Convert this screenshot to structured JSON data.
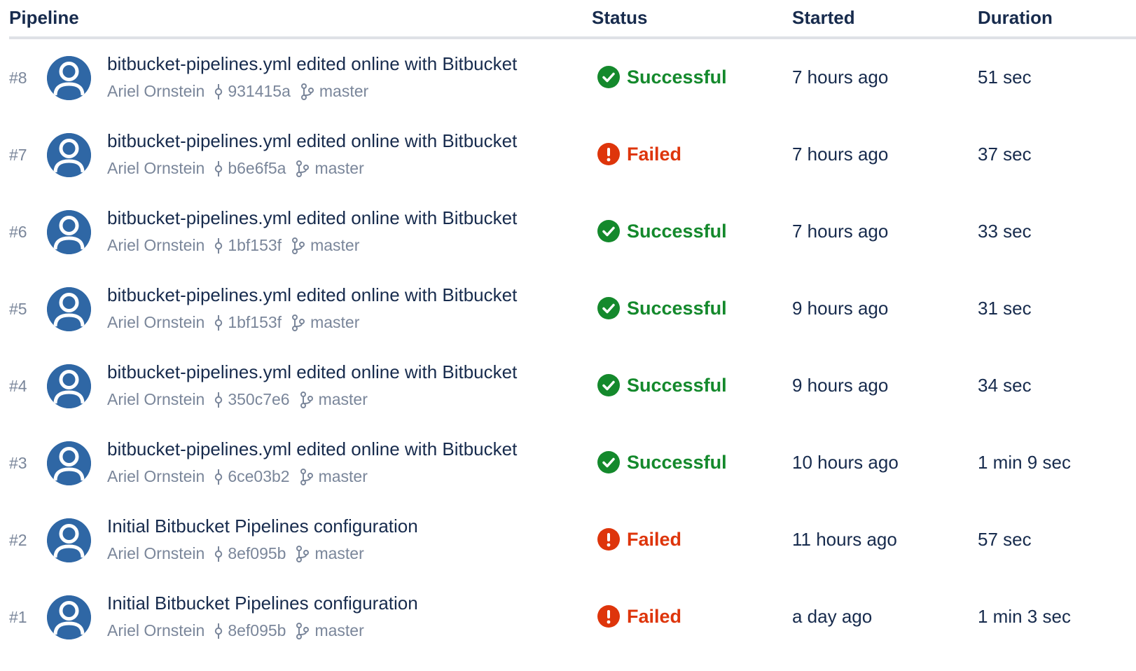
{
  "columns": {
    "pipeline": "Pipeline",
    "status": "Status",
    "started": "Started",
    "duration": "Duration"
  },
  "colors": {
    "success": "#14892c",
    "failed": "#de350b",
    "avatar": "#2f67a5",
    "text": "#172b4d",
    "muted": "#7a869a"
  },
  "rows": [
    {
      "number": "#8",
      "message": "bitbucket-pipelines.yml edited online with Bitbucket",
      "author": "Ariel Ornstein",
      "commit": "931415a",
      "branch": "master",
      "status": "Successful",
      "status_type": "success",
      "started": "7 hours ago",
      "duration": "51 sec"
    },
    {
      "number": "#7",
      "message": "bitbucket-pipelines.yml edited online with Bitbucket",
      "author": "Ariel Ornstein",
      "commit": "b6e6f5a",
      "branch": "master",
      "status": "Failed",
      "status_type": "failed",
      "started": "7 hours ago",
      "duration": "37 sec"
    },
    {
      "number": "#6",
      "message": "bitbucket-pipelines.yml edited online with Bitbucket",
      "author": "Ariel Ornstein",
      "commit": "1bf153f",
      "branch": "master",
      "status": "Successful",
      "status_type": "success",
      "started": "7 hours ago",
      "duration": "33 sec"
    },
    {
      "number": "#5",
      "message": "bitbucket-pipelines.yml edited online with Bitbucket",
      "author": "Ariel Ornstein",
      "commit": "1bf153f",
      "branch": "master",
      "status": "Successful",
      "status_type": "success",
      "started": "9 hours ago",
      "duration": "31 sec"
    },
    {
      "number": "#4",
      "message": "bitbucket-pipelines.yml edited online with Bitbucket",
      "author": "Ariel Ornstein",
      "commit": "350c7e6",
      "branch": "master",
      "status": "Successful",
      "status_type": "success",
      "started": "9 hours ago",
      "duration": "34 sec"
    },
    {
      "number": "#3",
      "message": "bitbucket-pipelines.yml edited online with Bitbucket",
      "author": "Ariel Ornstein",
      "commit": "6ce03b2",
      "branch": "master",
      "status": "Successful",
      "status_type": "success",
      "started": "10 hours ago",
      "duration": "1 min 9 sec"
    },
    {
      "number": "#2",
      "message": "Initial Bitbucket Pipelines configuration",
      "author": "Ariel Ornstein",
      "commit": "8ef095b",
      "branch": "master",
      "status": "Failed",
      "status_type": "failed",
      "started": "11 hours ago",
      "duration": "57 sec"
    },
    {
      "number": "#1",
      "message": "Initial Bitbucket Pipelines configuration",
      "author": "Ariel Ornstein",
      "commit": "8ef095b",
      "branch": "master",
      "status": "Failed",
      "status_type": "failed",
      "started": "a day ago",
      "duration": "1 min 3 sec"
    }
  ],
  "icons": {
    "avatar": "default-avatar-icon",
    "commit": "commit-icon",
    "branch": "branch-icon",
    "success": "check-circle-icon",
    "failed": "error-circle-icon"
  }
}
